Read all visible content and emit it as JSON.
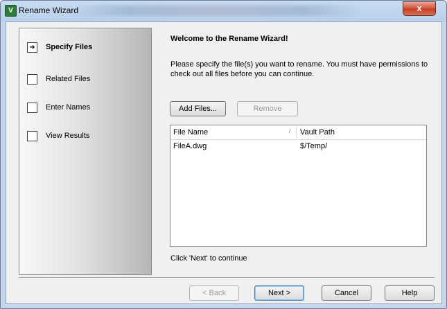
{
  "window": {
    "title": "Rename Wizard",
    "app_icon_glyph": "V",
    "close_glyph": "x"
  },
  "sidebar": {
    "steps": [
      {
        "label": "Specify Files",
        "current": true,
        "marker": "➜"
      },
      {
        "label": "Related Files",
        "current": false,
        "marker": ""
      },
      {
        "label": "Enter Names",
        "current": false,
        "marker": ""
      },
      {
        "label": "View Results",
        "current": false,
        "marker": ""
      }
    ]
  },
  "main": {
    "heading": "Welcome to the Rename Wizard!",
    "description": "Please specify the file(s) you want to rename.  You must have permissions to check out all files before you can continue.",
    "add_files_label": "Add Files...",
    "remove_label": "Remove",
    "columns": {
      "file_name": "File Name",
      "vault_path": "Vault Path"
    },
    "rows": [
      {
        "file_name": "FileA.dwg",
        "vault_path": "$/Temp/"
      }
    ],
    "hint": "Click 'Next' to continue"
  },
  "footer": {
    "back_label": "< Back",
    "next_label": "Next >",
    "cancel_label": "Cancel",
    "help_label": "Help"
  }
}
